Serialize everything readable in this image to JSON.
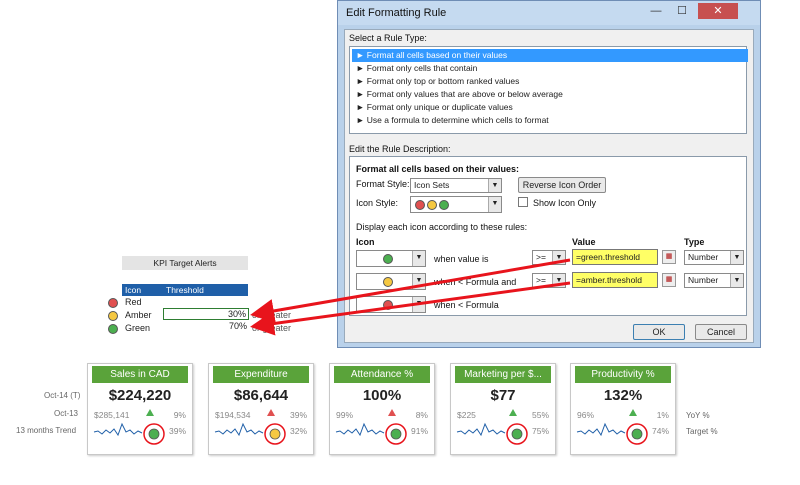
{
  "dialog": {
    "title": "Edit Formatting Rule",
    "minimize": "—",
    "maximize": "☐",
    "close": "✕",
    "select_rule_type_label": "Select a Rule Type:",
    "rule_types": [
      "► Format all cells based on their values",
      "► Format only cells that contain",
      "► Format only top or bottom ranked values",
      "► Format only values that are above or below average",
      "► Format only unique or duplicate values",
      "► Use a formula to determine which cells to format"
    ],
    "edit_desc_label": "Edit the Rule Description:",
    "desc_heading": "Format all cells based on their values:",
    "format_style_label": "Format Style:",
    "format_style_value": "Icon Sets",
    "reverse_icon_order": "Reverse Icon Order",
    "icon_style_label": "Icon Style:",
    "show_icon_only": "Show Icon Only",
    "display_each_icon": "Display each icon according to these rules:",
    "col_icon": "Icon",
    "col_value": "Value",
    "col_type": "Type",
    "rows": [
      {
        "cond": "when value is",
        "op": ">=",
        "value": "=green.threshold",
        "type": "Number",
        "color": "#4caf50"
      },
      {
        "cond": "when < Formula and",
        "op": ">=",
        "value": "=amber.threshold",
        "type": "Number",
        "color": "#f5c842"
      },
      {
        "cond": "when < Formula",
        "color": "#e05050"
      }
    ],
    "ok": "OK",
    "cancel": "Cancel",
    "colors": {
      "red": "#e05050",
      "amber": "#f5c842",
      "green": "#4caf50"
    }
  },
  "legend": {
    "title": "KPI Target Alerts",
    "col_icon": "Icon",
    "col_threshold": "Threshold",
    "rows": [
      {
        "label": "Red",
        "threshold": "",
        "suffix": "",
        "color": "#e05050"
      },
      {
        "label": "Amber",
        "threshold": "30%",
        "suffix": "or greater",
        "color": "#f5c842"
      },
      {
        "label": "Green",
        "threshold": "70%",
        "suffix": "or greater",
        "color": "#4caf50"
      }
    ]
  },
  "row_labels": {
    "current": "Oct-14 (T)",
    "previous": "Oct-13",
    "trend": "13 months Trend",
    "yoy": "YoY %",
    "target": "Target %"
  },
  "cards": [
    {
      "title": "Sales in CAD",
      "value": "$224,220",
      "prev": "$285,141",
      "yoy": "9%",
      "target": "39%",
      "dot": "#4caf50",
      "tri": "#4caf50"
    },
    {
      "title": "Expenditure",
      "value": "$86,644",
      "prev": "$194,534",
      "yoy": "39%",
      "target": "32%",
      "dot": "#f5c842",
      "tri": "#e05050"
    },
    {
      "title": "Attendance %",
      "value": "100%",
      "prev": "99%",
      "yoy": "8%",
      "target": "91%",
      "dot": "#4caf50",
      "tri": "#e05050"
    },
    {
      "title": "Marketing per $...",
      "value": "$77",
      "prev": "$225",
      "yoy": "55%",
      "target": "75%",
      "dot": "#4caf50",
      "tri": "#4caf50"
    },
    {
      "title": "Productivity %",
      "value": "132%",
      "prev": "96%",
      "yoy": "1%",
      "target": "74%",
      "dot": "#4caf50",
      "tri": "#4caf50"
    }
  ]
}
